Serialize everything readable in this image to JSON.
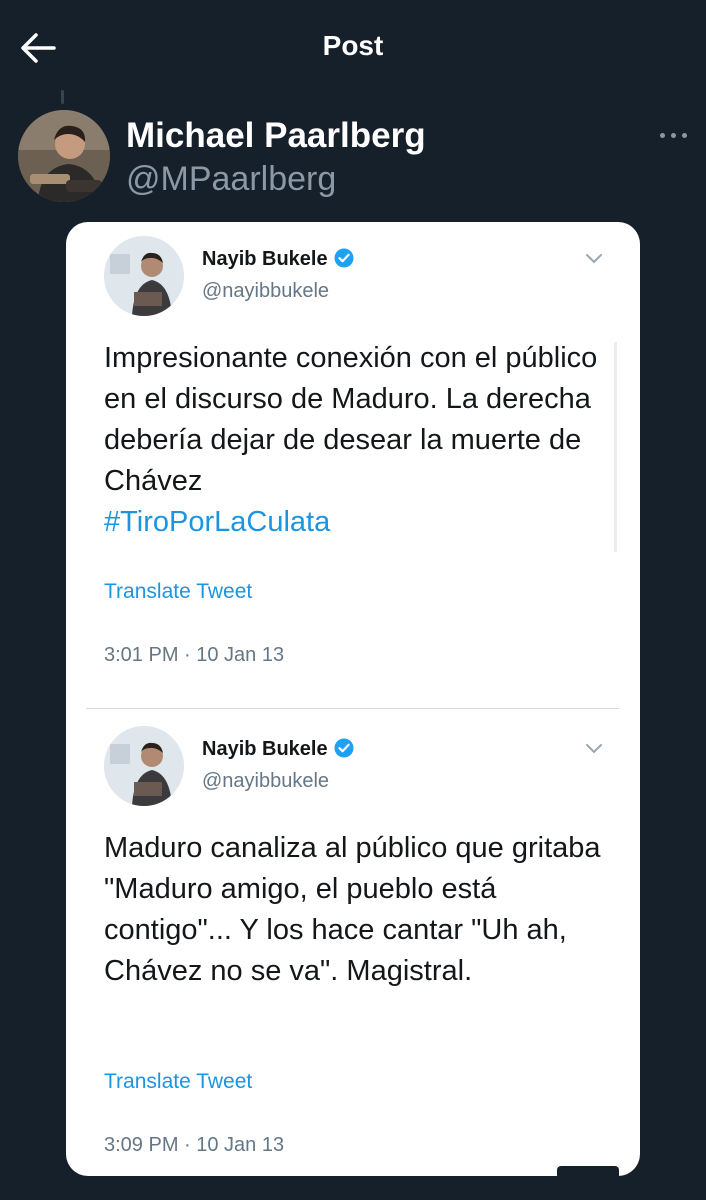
{
  "header": {
    "title": "Post",
    "back_icon": "arrow-left-icon"
  },
  "author": {
    "name": "Michael Paarlberg",
    "handle": "@MPaarlberg",
    "more_icon": "more-horizontal-icon"
  },
  "embedded_tweets": [
    {
      "name": "Nayib Bukele",
      "handle": "@nayibbukele",
      "verified": true,
      "text": "Impresionante conexión con el público en el discurso de Maduro. La derecha debería dejar de desear la muerte de Chávez",
      "hashtag": "#TiroPorLaCulata",
      "translate_label": "Translate Tweet",
      "timestamp": "3:01 PM · 10 Jan 13"
    },
    {
      "name": "Nayib Bukele",
      "handle": "@nayibbukele",
      "verified": true,
      "text": "Maduro canaliza al público que gritaba \"Maduro amigo, el pueblo está contigo\"... Y los hace cantar \"Uh ah, Chávez no se va\". Magistral.",
      "translate_label": "Translate Tweet",
      "timestamp": "3:09 PM · 10 Jan 13"
    }
  ],
  "colors": {
    "background": "#15202b",
    "link": "#1b95e0",
    "verified": "#1da1f2",
    "secondary_text": "#8b98a5"
  }
}
